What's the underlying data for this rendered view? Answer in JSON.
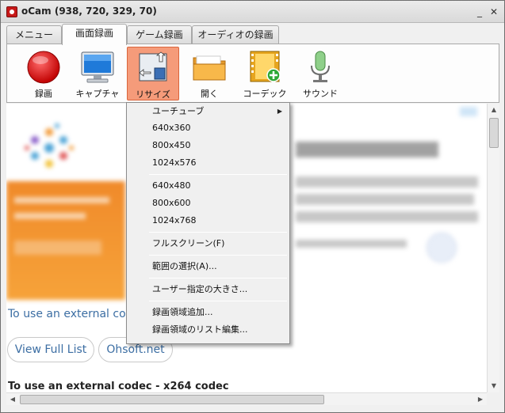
{
  "window": {
    "title": "oCam (938, 720, 329, 70)"
  },
  "tabs": [
    {
      "label": "メニュー"
    },
    {
      "label": "画面録画"
    },
    {
      "label": "ゲーム録画"
    },
    {
      "label": "オーディオの録画"
    }
  ],
  "toolbar": {
    "record_label": "録画",
    "capture_label": "キャプチャ",
    "resize_label": "リサイズ",
    "open_label": "開く",
    "codec_label": "コーデック",
    "sound_label": "サウンド"
  },
  "resize_menu": {
    "items": [
      "ユーチューブ",
      "640x360",
      "800x450",
      "1024x576",
      "640x480",
      "800x600",
      "1024x768",
      "フルスクリーン(F)",
      "範囲の選択(A)...",
      "ユーザー指定の大きさ...",
      "録画領域追加...",
      "録画領域のリスト編集..."
    ]
  },
  "page": {
    "external_codec_link": "To use an external codec",
    "view_full_list_button": "View Full List",
    "ohsoft_button": "Ohsoft.net",
    "bottom_heading": "To use an external codec - x264 codec"
  },
  "colors": {
    "accent_selected": "#f59b7a",
    "link": "#3c6ea3",
    "orange_banner": "#f08a2a"
  }
}
